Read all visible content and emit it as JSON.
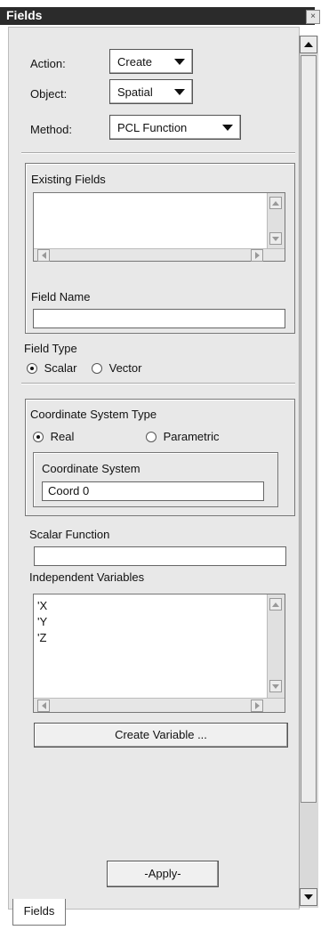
{
  "window": {
    "title": "Fields",
    "close_glyph": "×"
  },
  "action": {
    "label": "Action:",
    "value": "Create"
  },
  "object": {
    "label": "Object:",
    "value": "Spatial"
  },
  "method": {
    "label": "Method:",
    "value": "PCL Function"
  },
  "existing_fields": {
    "label": "Existing Fields",
    "items": []
  },
  "field_name": {
    "label": "Field Name",
    "value": ""
  },
  "field_type": {
    "label": "Field Type",
    "options": [
      "Scalar",
      "Vector"
    ],
    "selected": "Scalar"
  },
  "coord_type": {
    "label": "Coordinate System Type",
    "options": [
      "Real",
      "Parametric"
    ],
    "selected": "Real"
  },
  "coord_system": {
    "label": "Coordinate System",
    "value": "Coord 0"
  },
  "scalar_function": {
    "label": "Scalar Function",
    "value": ""
  },
  "independent_vars": {
    "label": "Independent Variables",
    "items": [
      "'X",
      "'Y",
      "'Z"
    ]
  },
  "create_variable_label": "Create Variable ...",
  "apply_label": "-Apply-",
  "tab_label": "Fields"
}
